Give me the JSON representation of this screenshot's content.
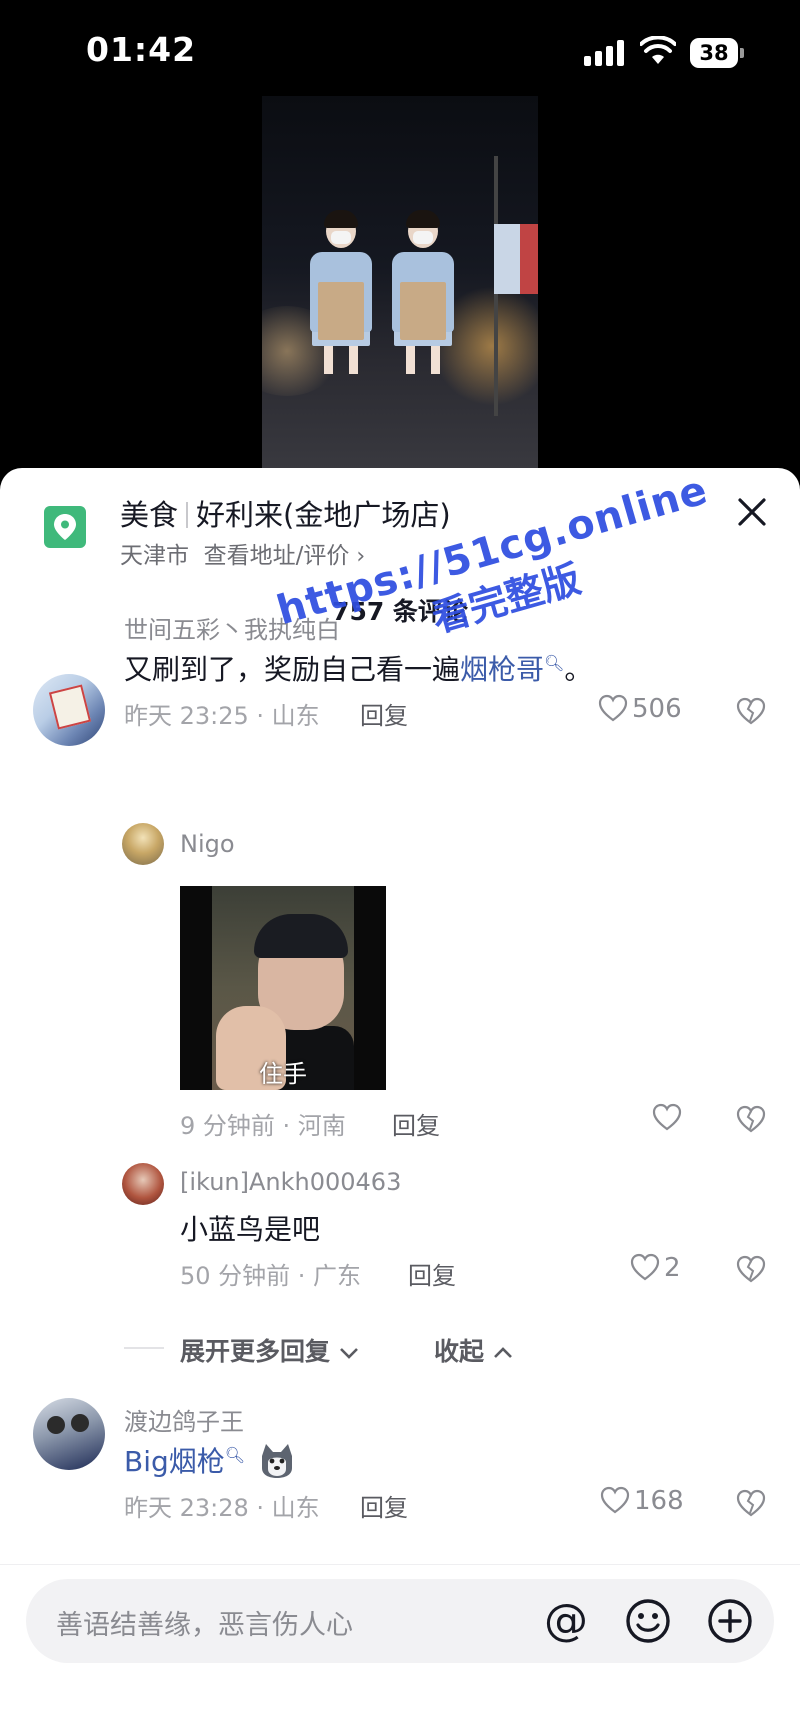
{
  "status_bar": {
    "time": "01:42",
    "battery": "38",
    "icons": [
      "signal-icon",
      "wifi-icon",
      "battery-icon"
    ]
  },
  "poi": {
    "category": "美食",
    "name": "好利来(金地广场店)",
    "city": "天津市",
    "link": "查看地址/评价",
    "icon": "location-pin-icon",
    "accent": "#3fb97b"
  },
  "comment_count": "757 条评论",
  "comments": [
    {
      "user": "世间五彩丶我执纯白",
      "text_before": "又刷到了，奖励自己看一遍",
      "search_term": "烟枪哥",
      "text_after": "。",
      "meta": "昨天 23:25 · 山东",
      "reply": "回复",
      "likes": "506"
    },
    {
      "user": "渡边鸽子王",
      "search_term": "Big烟枪",
      "emoji": "husky-emoji",
      "meta": "昨天 23:28 · 山东",
      "reply": "回复",
      "likes": "168"
    }
  ],
  "replies": [
    {
      "user": "Nigo",
      "sticker_caption": "住手",
      "meta": "9 分钟前 · 河南",
      "reply": "回复",
      "likes": ""
    },
    {
      "user": "[ikun]Ankh000463",
      "text": "小蓝鸟是吧",
      "meta": "50 分钟前 · 广东",
      "reply": "回复",
      "likes": "2"
    }
  ],
  "expand": {
    "more": "展开更多回复",
    "collapse": "收起"
  },
  "input": {
    "placeholder": "善语结善缘，恶言伤人心",
    "icons": [
      "at-icon",
      "emoji-icon",
      "plus-icon"
    ]
  },
  "watermark": {
    "line1": "https://51cg.online",
    "line2": "看完整版",
    "color": "#2f4ee0"
  },
  "colors": {
    "link": "#3b5ba9",
    "text": "#161823",
    "muted": "#a3a4a9"
  }
}
